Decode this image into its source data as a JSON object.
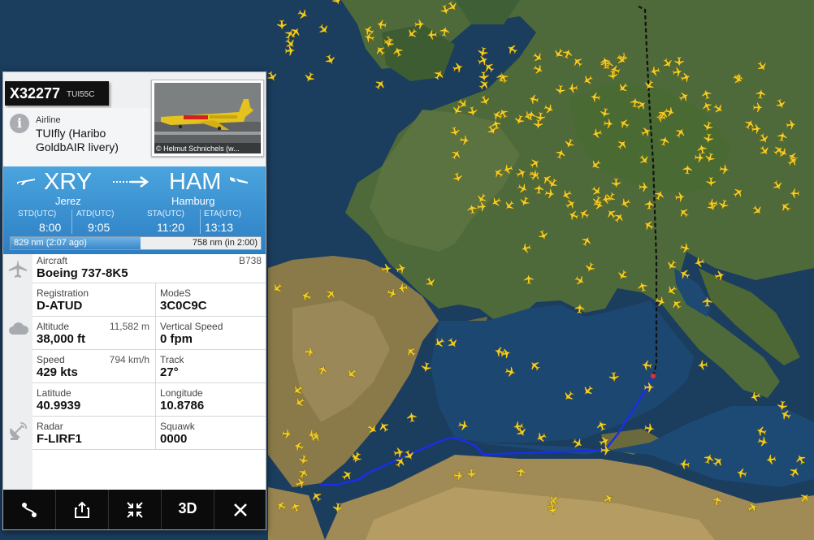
{
  "flight": {
    "callsign": "X32277",
    "flight_code": "TUI55C"
  },
  "airline": {
    "label": "Airline",
    "name": "TUIfly (Haribo GoldbAIR livery)"
  },
  "photo": {
    "credit": "© Helmut Schnichels (w..."
  },
  "route": {
    "origin_code": "XRY",
    "origin_city": "Jerez",
    "destination_code": "HAM",
    "destination_city": "Hamburg"
  },
  "times": {
    "std_label": "STD",
    "atd_label": "ATD",
    "sta_label": "STA",
    "eta_label": "ETA",
    "utc": "(UTC)",
    "std": "8:00",
    "atd": "9:05",
    "sta": "11:20",
    "eta": "13:13"
  },
  "progress": {
    "flown": "829 nm (2:07 ago)",
    "remaining": "758 nm (in 2:00)",
    "fraction": 0.52
  },
  "details": {
    "aircraft_label": "Aircraft",
    "aircraft_value": "Boeing 737-8K5",
    "aircraft_code": "B738",
    "registration_label": "Registration",
    "registration_value": "D-ATUD",
    "modes_label": "ModeS",
    "modes_value": "3C0C9C",
    "altitude_label": "Altitude",
    "altitude_value": "38,000 ft",
    "altitude_metric": "11,582 m",
    "vspeed_label": "Vertical Speed",
    "vspeed_value": "0 fpm",
    "speed_label": "Speed",
    "speed_value": "429 kts",
    "speed_metric": "794 km/h",
    "track_label": "Track",
    "track_value": "27°",
    "latitude_label": "Latitude",
    "latitude_value": "40.9939",
    "longitude_label": "Longitude",
    "longitude_value": "10.8786",
    "radar_label": "Radar",
    "radar_value": "F-LIRF1",
    "squawk_label": "Squawk",
    "squawk_value": "0000"
  },
  "toolbar": {
    "route_icon": "route-icon",
    "share_icon": "share-icon",
    "collapse_icon": "collapse-icon",
    "threed_label": "3D",
    "close_icon": "close-icon"
  },
  "colors": {
    "flown_track": "#1a2ee8",
    "planned_track": "#111111",
    "traffic": "#f4cf25",
    "header_blue": "#2d7fc4"
  }
}
